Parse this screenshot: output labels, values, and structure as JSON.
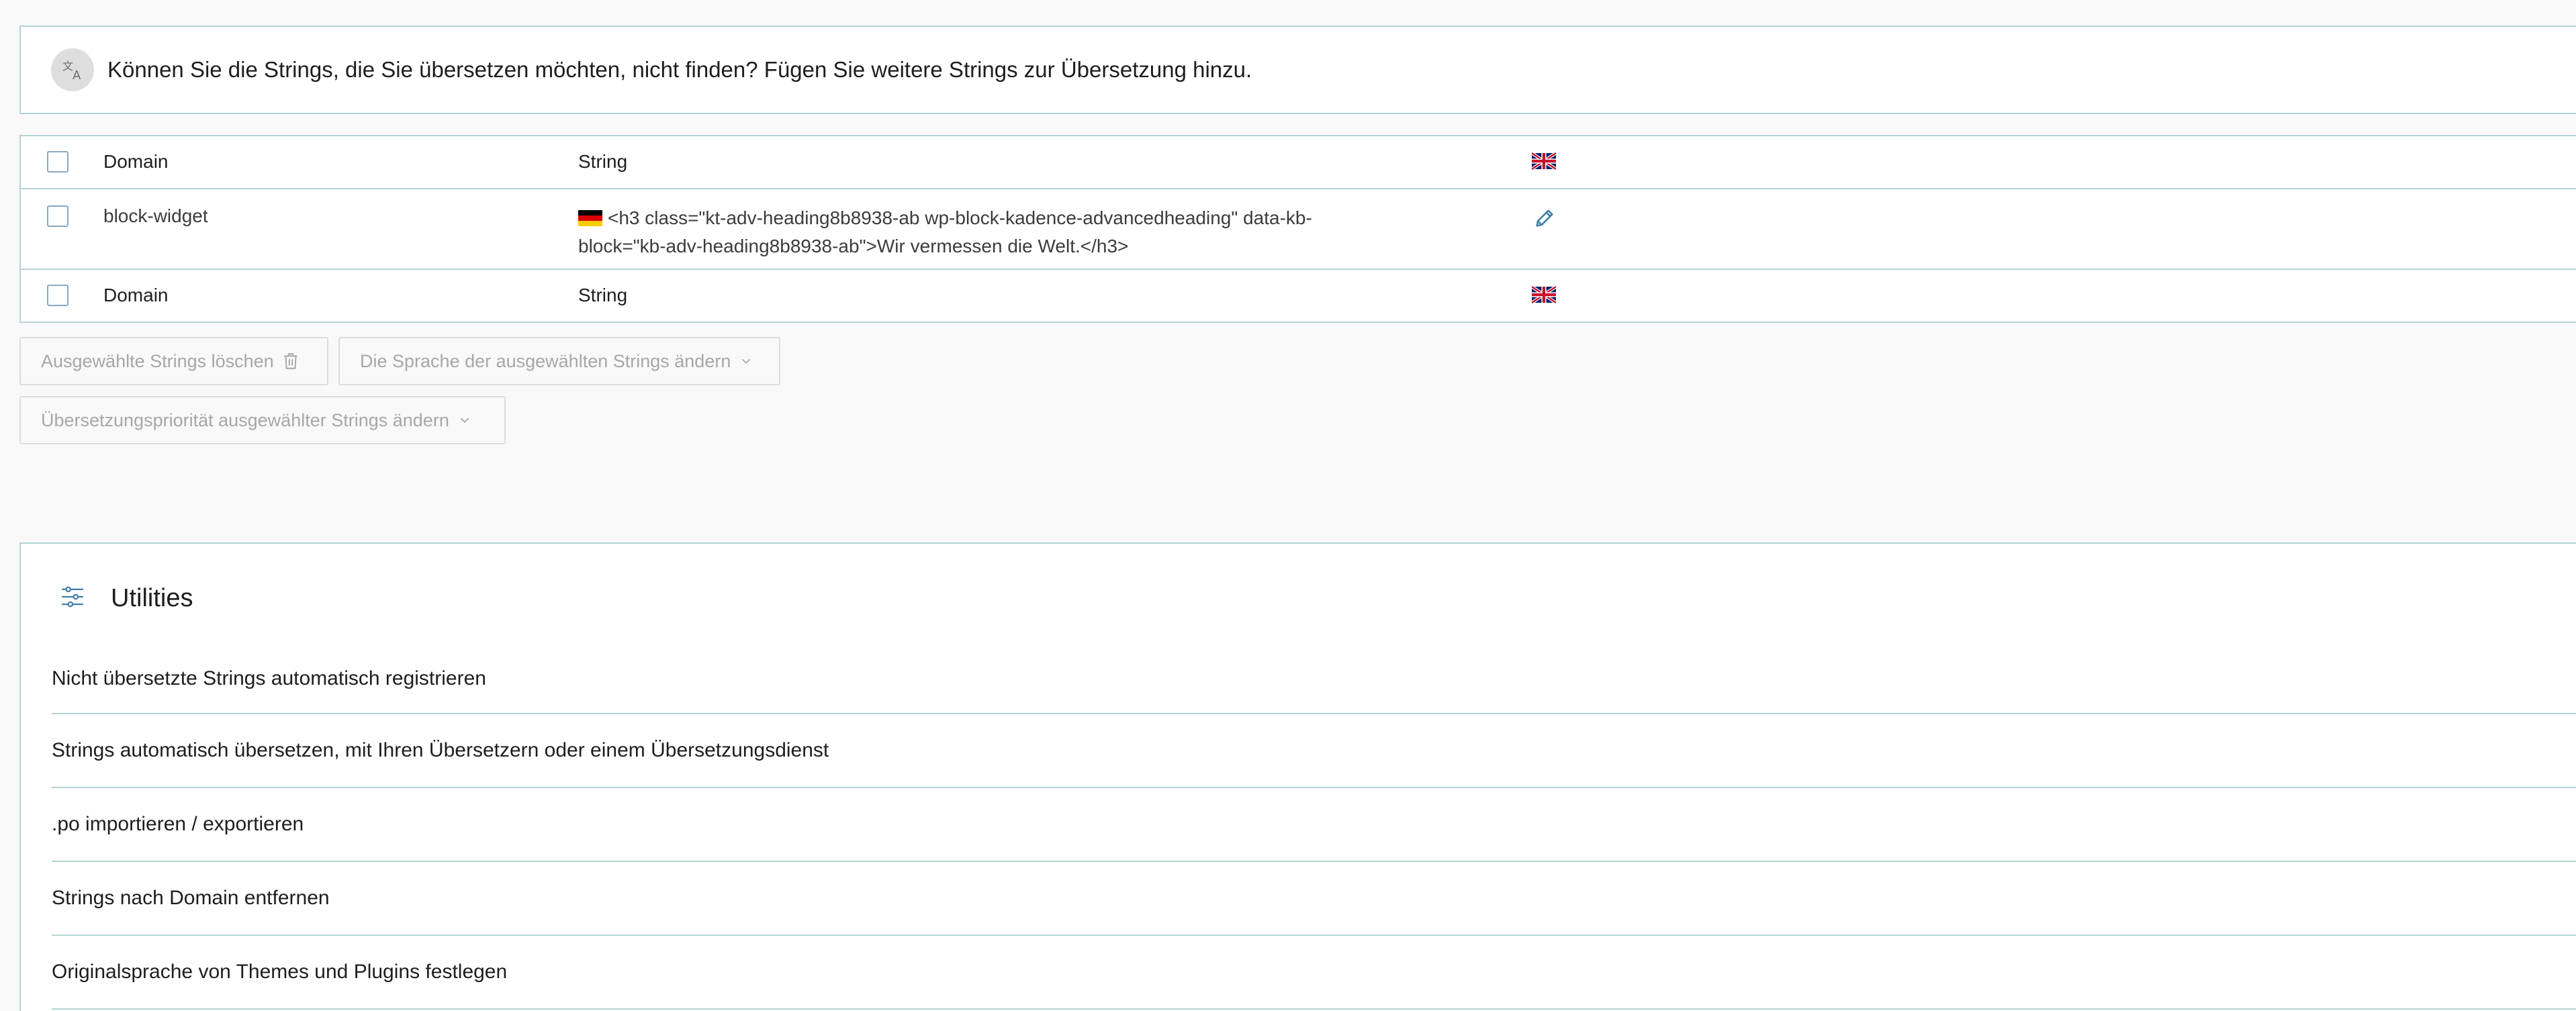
{
  "notice": {
    "text": "Können Sie die Strings, die Sie übersetzen möchten, nicht finden? Fügen Sie weitere Strings zur Übersetzung hinzu.",
    "icon": "translate-icon"
  },
  "table": {
    "header": {
      "domain": "Domain",
      "string": "String",
      "language_icon": "uk-flag-icon"
    },
    "rows": [
      {
        "domain": "block-widget",
        "string_language_icon": "german-flag-icon",
        "string": "<h3 class=\"kt-adv-heading8b8938-ab wp-block-kadence-advancedheading\" data-kb-block=\"kb-adv-heading8b8938-ab\">Wir vermessen die Welt.</h3>",
        "action_icon": "pencil-icon"
      }
    ],
    "footer": {
      "domain": "Domain",
      "string": "String",
      "language_icon": "uk-flag-icon"
    }
  },
  "actions": {
    "delete_label": "Ausgewählte Strings löschen",
    "change_language_label": "Die Sprache der ausgewählten Strings ändern",
    "change_priority_label": "Übersetzungspriorität ausgewählter Strings ändern"
  },
  "utilities": {
    "title": "Utilities",
    "items": [
      "Nicht übersetzte Strings automatisch registrieren",
      "Strings automatisch übersetzen, mit Ihren Übersetzern oder einem Übersetzungsdienst",
      ".po importieren / exportieren",
      "Strings nach Domain entfernen",
      "Originalsprache von Themes und Plugins festlegen"
    ]
  },
  "colors": {
    "border": "#b4d4d3",
    "checkbox_border": "#8aa9c1",
    "disabled_text": "#a7a7a7",
    "accent": "#3f7fa6"
  }
}
